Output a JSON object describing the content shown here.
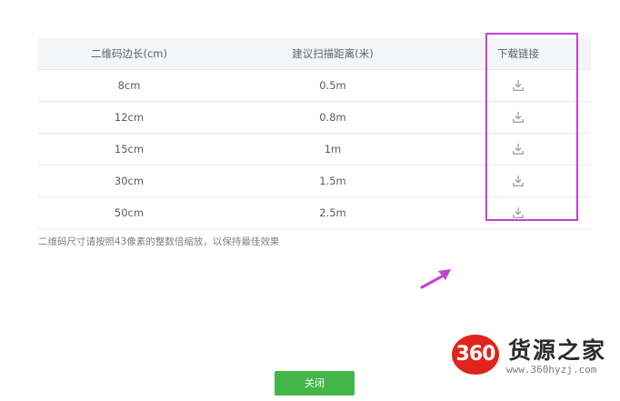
{
  "table": {
    "headers": {
      "size": "二维码边长(cm)",
      "distance": "建议扫描距离(米)",
      "download": "下载链接"
    },
    "rows": [
      {
        "size": "8cm",
        "distance": "0.5m"
      },
      {
        "size": "12cm",
        "distance": "0.8m"
      },
      {
        "size": "15cm",
        "distance": "1m"
      },
      {
        "size": "30cm",
        "distance": "1.5m"
      },
      {
        "size": "50cm",
        "distance": "2.5m"
      }
    ],
    "download_icon": "download-icon"
  },
  "note": "二维码尺寸请按照43像素的整数倍缩放，以保持最佳效果",
  "close_label": "关闭",
  "watermark": {
    "badge": "360",
    "name": "货源之家",
    "url": "www.360hyzj.com"
  },
  "colors": {
    "highlight": "#c53fd9",
    "arrow": "#c53fd9",
    "close_button": "#44b549",
    "watermark_badge": "#e0241c"
  }
}
